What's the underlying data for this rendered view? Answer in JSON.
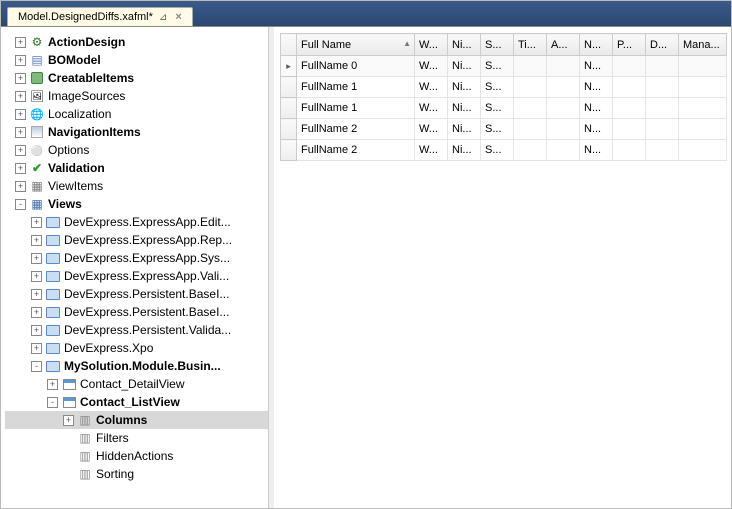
{
  "tab": {
    "title": "Model.DesignedDiffs.xafml*"
  },
  "tree": [
    {
      "d": 0,
      "t": "+",
      "i": "ico-action",
      "l": "ActionDesign",
      "b": 1
    },
    {
      "d": 0,
      "t": "+",
      "i": "ico-bo",
      "l": "BOModel",
      "b": 1
    },
    {
      "d": 0,
      "t": "+",
      "i": "ico-creatable",
      "l": "CreatableItems",
      "b": 1
    },
    {
      "d": 0,
      "t": "+",
      "i": "ico-imgsrc",
      "l": "ImageSources",
      "b": 0
    },
    {
      "d": 0,
      "t": "+",
      "i": "ico-loc",
      "l": "Localization",
      "b": 0
    },
    {
      "d": 0,
      "t": "+",
      "i": "ico-nav",
      "l": "NavigationItems",
      "b": 1
    },
    {
      "d": 0,
      "t": "+",
      "i": "ico-opt",
      "l": "Options",
      "b": 0
    },
    {
      "d": 0,
      "t": "+",
      "i": "ico-valid",
      "l": "Validation",
      "b": 1
    },
    {
      "d": 0,
      "t": "+",
      "i": "ico-view",
      "l": "ViewItems",
      "b": 0
    },
    {
      "d": 0,
      "t": "-",
      "i": "ico-views",
      "l": "Views",
      "b": 1
    },
    {
      "d": 1,
      "t": "+",
      "i": "ico-folder blue",
      "l": "DevExpress.ExpressApp.Edit...",
      "b": 0
    },
    {
      "d": 1,
      "t": "+",
      "i": "ico-folder blue",
      "l": "DevExpress.ExpressApp.Rep...",
      "b": 0
    },
    {
      "d": 1,
      "t": "+",
      "i": "ico-folder blue",
      "l": "DevExpress.ExpressApp.Sys...",
      "b": 0
    },
    {
      "d": 1,
      "t": "+",
      "i": "ico-folder blue",
      "l": "DevExpress.ExpressApp.Vali...",
      "b": 0
    },
    {
      "d": 1,
      "t": "+",
      "i": "ico-folder blue",
      "l": "DevExpress.Persistent.BaseI...",
      "b": 0
    },
    {
      "d": 1,
      "t": "+",
      "i": "ico-folder blue",
      "l": "DevExpress.Persistent.BaseI...",
      "b": 0
    },
    {
      "d": 1,
      "t": "+",
      "i": "ico-folder blue",
      "l": "DevExpress.Persistent.Valida...",
      "b": 0
    },
    {
      "d": 1,
      "t": "+",
      "i": "ico-folder blue",
      "l": "DevExpress.Xpo",
      "b": 0
    },
    {
      "d": 1,
      "t": "-",
      "i": "ico-folder blue",
      "l": "MySolution.Module.Busin...",
      "b": 1
    },
    {
      "d": 2,
      "t": "+",
      "i": "ico-grid",
      "l": "Contact_DetailView",
      "b": 0
    },
    {
      "d": 2,
      "t": "-",
      "i": "ico-grid",
      "l": "Contact_ListView",
      "b": 1
    },
    {
      "d": 3,
      "t": "+",
      "i": "ico-cols",
      "l": "Columns",
      "b": 1,
      "sel": 1
    },
    {
      "d": 3,
      "t": " ",
      "i": "ico-cols",
      "l": "Filters",
      "b": 0
    },
    {
      "d": 3,
      "t": " ",
      "i": "ico-cols",
      "l": "HiddenActions",
      "b": 0
    },
    {
      "d": 3,
      "t": " ",
      "i": "ico-cols",
      "l": "Sorting",
      "b": 0
    }
  ],
  "grid": {
    "columns": [
      "Full Name",
      "W...",
      "Ni...",
      "S...",
      "Ti...",
      "A...",
      "N...",
      "P...",
      "D...",
      "Mana..."
    ],
    "sortCol": 0,
    "rows": [
      {
        "ind": "▸",
        "c": [
          "FullName 0",
          "W...",
          "Ni...",
          "S...",
          "",
          "",
          "N...",
          "",
          "",
          ""
        ]
      },
      {
        "ind": "",
        "c": [
          "FullName 1",
          "W...",
          "Ni...",
          "S...",
          "",
          "",
          "N...",
          "",
          "",
          ""
        ]
      },
      {
        "ind": "",
        "c": [
          "FullName 1",
          "W...",
          "Ni...",
          "S...",
          "",
          "",
          "N...",
          "",
          "",
          ""
        ]
      },
      {
        "ind": "",
        "c": [
          "FullName 2",
          "W...",
          "Ni...",
          "S...",
          "",
          "",
          "N...",
          "",
          "",
          ""
        ]
      },
      {
        "ind": "",
        "c": [
          "FullName 2",
          "W...",
          "Ni...",
          "S...",
          "",
          "",
          "N...",
          "",
          "",
          ""
        ]
      }
    ]
  }
}
